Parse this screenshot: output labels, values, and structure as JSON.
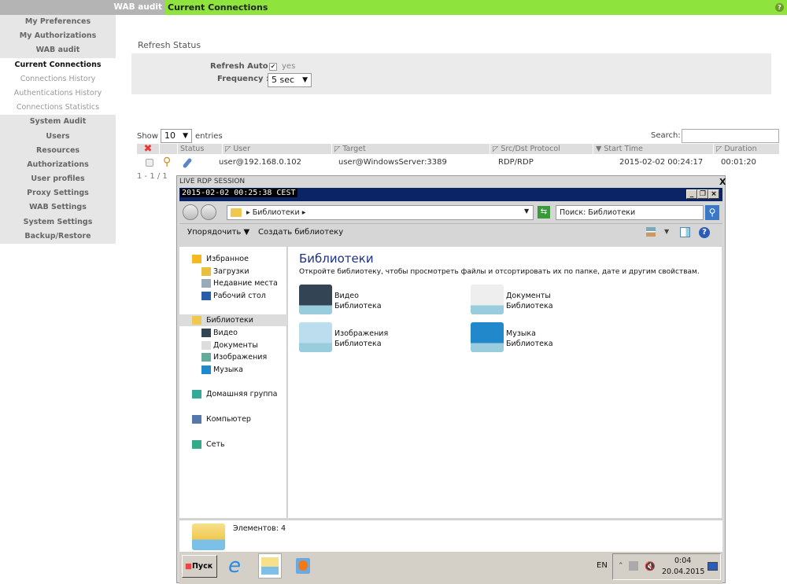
{
  "topbar": {
    "section": "WAB audit",
    "page": "Current Connections",
    "help_icon": "help-icon"
  },
  "sidebar": {
    "items": [
      {
        "label": "My Preferences",
        "type": "top"
      },
      {
        "label": "My Authorizations",
        "type": "top"
      },
      {
        "label": "WAB audit",
        "type": "top"
      },
      {
        "label": "Current Connections",
        "type": "sub-active"
      },
      {
        "label": "Connections History",
        "type": "sub"
      },
      {
        "label": "Authentications History",
        "type": "sub"
      },
      {
        "label": "Connections Statistics",
        "type": "sub"
      },
      {
        "label": "System Audit",
        "type": "top"
      },
      {
        "label": "Users",
        "type": "top"
      },
      {
        "label": "Resources",
        "type": "top"
      },
      {
        "label": "Authorizations",
        "type": "top"
      },
      {
        "label": "User profiles",
        "type": "top"
      },
      {
        "label": "Proxy Settings",
        "type": "top"
      },
      {
        "label": "WAB Settings",
        "type": "top"
      },
      {
        "label": "System Settings",
        "type": "top"
      },
      {
        "label": "Backup/Restore",
        "type": "top"
      }
    ]
  },
  "refresh": {
    "title": "Refresh Status",
    "auto_label": "Refresh Auto :",
    "auto_checked": true,
    "auto_value": "yes",
    "frequency_label": "Frequency :",
    "frequency_value": "5 sec"
  },
  "table": {
    "show_label": "Show",
    "entries_value": "10",
    "entries_label": "entries",
    "search_label": "Search:",
    "search_value": "",
    "columns": [
      "Status",
      "User",
      "Target",
      "Src/Dst Protocol",
      "Start Time",
      "Duration"
    ],
    "sorted_column": "Start Time",
    "rows": [
      {
        "user": "user@192.168.0.102",
        "target": "user@WindowsServer:3389",
        "protocol": "RDP/RDP",
        "start": "2015-02-02 00:24:17",
        "duration": "00:01:20"
      }
    ],
    "pagination": "1 - 1 / 1"
  },
  "rdp": {
    "title": "LIVE RDP SESSION",
    "close": "X",
    "timestamp": "2015-02-02 00:25:38 CEST",
    "explorer": {
      "address": "▸ Библиотеки ▸",
      "search_placeholder": "Поиск: Библиотеки",
      "organize": "Упорядочить",
      "create_library": "Создать библиотеку",
      "nav": [
        {
          "label": "Избранное",
          "level": 0
        },
        {
          "label": "Загрузки",
          "level": 1
        },
        {
          "label": "Недавние места",
          "level": 1
        },
        {
          "label": "Рабочий стол",
          "level": 1
        },
        {
          "label": "Библиотеки",
          "level": 0,
          "selected": true
        },
        {
          "label": "Видео",
          "level": 1
        },
        {
          "label": "Документы",
          "level": 1
        },
        {
          "label": "Изображения",
          "level": 1
        },
        {
          "label": "Музыка",
          "level": 1
        },
        {
          "label": "Домашняя группа",
          "level": 0
        },
        {
          "label": "Компьютер",
          "level": 0
        },
        {
          "label": "Сеть",
          "level": 0
        }
      ],
      "heading": "Библиотеки",
      "description": "Откройте библиотеку, чтобы просмотреть файлы и отсортировать их по папке, дате и другим свойствам.",
      "libraries": [
        {
          "name": "Видео",
          "type": "Библиотека"
        },
        {
          "name": "Документы",
          "type": "Библиотека"
        },
        {
          "name": "Изображения",
          "type": "Библиотека"
        },
        {
          "name": "Музыка",
          "type": "Библиотека"
        }
      ],
      "status": "Элементов: 4"
    },
    "taskbar": {
      "start": "Пуск",
      "lang": "EN",
      "time": "0:04",
      "date": "20.04.2015"
    }
  },
  "colors": {
    "accent": "#8ee43c",
    "sidebar": "#e6e6e6",
    "rdp_title": "#0a2466"
  }
}
